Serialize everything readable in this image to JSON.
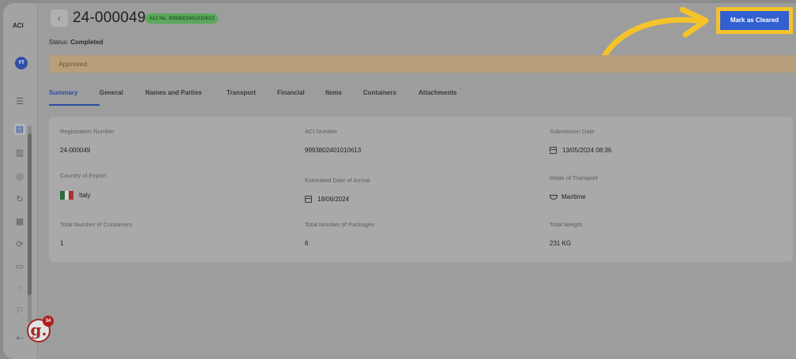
{
  "rail": {
    "brand": "ACI",
    "avatar": "YT",
    "icons": [
      "sliders-icon",
      "document-icon",
      "list-icon",
      "circle-icon",
      "refresh-icon",
      "file-icon",
      "sync-icon",
      "chat-icon",
      "support-icon",
      "flag-icon",
      "logout-icon"
    ]
  },
  "header": {
    "back_glyph": "‹",
    "title": "24-000049",
    "aci_pill": "ACI No. 9993802401010613",
    "status_label": "Status:",
    "status_value": "Completed",
    "action_button": "Mark as Cleared"
  },
  "banner": {
    "text": "Approved"
  },
  "tabs": [
    {
      "label": "Summary",
      "active": true
    },
    {
      "label": "General"
    },
    {
      "label": "Names and Parties"
    },
    {
      "label": "Transport"
    },
    {
      "label": "Financial"
    },
    {
      "label": "Items"
    },
    {
      "label": "Containers"
    },
    {
      "label": "Attachments"
    }
  ],
  "summary": {
    "registration_number": {
      "label": "Registration Number",
      "value": "24-000049"
    },
    "aci_number": {
      "label": "ACI Number",
      "value": "9993802401010613"
    },
    "submission_date": {
      "label": "Submission Date",
      "value": "13/05/2024 08:36"
    },
    "country_of_export": {
      "label": "Country of Export",
      "value": "Italy"
    },
    "estimated_arrival": {
      "label": "Estimated Date of Arrival",
      "value": "18/06/2024"
    },
    "mode_of_transport": {
      "label": "Mode of Transport",
      "value": "Maritime"
    },
    "total_containers": {
      "label": "Total Number of Containers",
      "value": "1"
    },
    "total_packages": {
      "label": "Total Number of Packages",
      "value": "6"
    },
    "total_weight": {
      "label": "Total Weight",
      "value": "231 KG"
    }
  },
  "badge": {
    "letter": "g.",
    "count": "34"
  },
  "colors": {
    "accent": "#2a4fa4",
    "highlight": "#f4c32a",
    "approved_bg": "#b8a07c",
    "pill_green": "#5aa85c"
  }
}
